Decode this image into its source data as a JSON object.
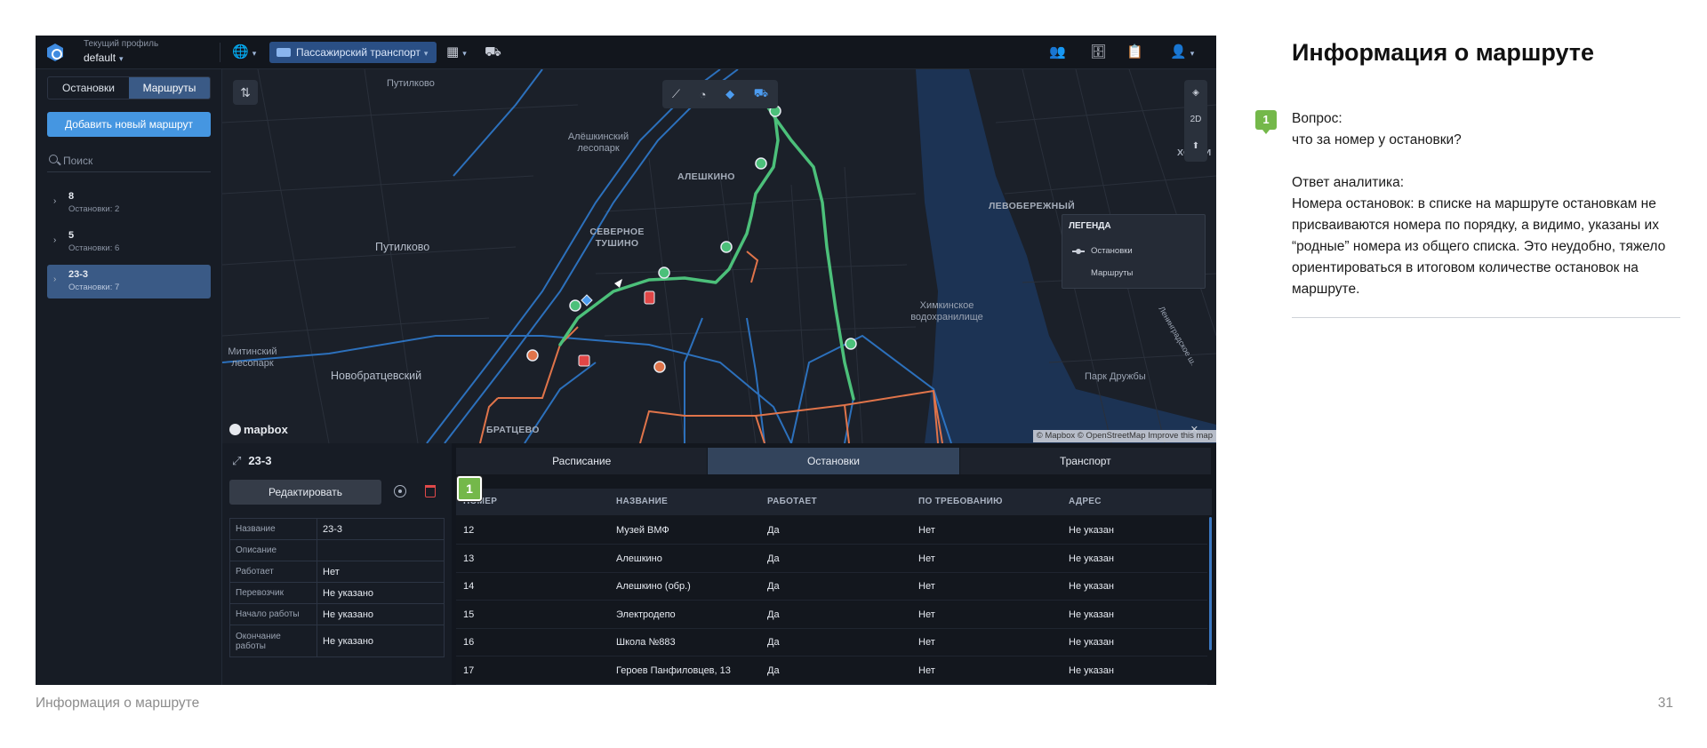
{
  "topbar": {
    "profile_caption": "Текущий профиль",
    "profile_value": "default",
    "mode": "Пассажирский транспорт"
  },
  "sidebar": {
    "tabs": [
      {
        "label": "Остановки",
        "active": false
      },
      {
        "label": "Маршруты",
        "active": true
      }
    ],
    "add_button": "Добавить новый маршрут",
    "search_placeholder": "Поиск",
    "routes": [
      {
        "name": "8",
        "stops": "Остановки: 2",
        "selected": false
      },
      {
        "name": "5",
        "stops": "Остановки: 6",
        "selected": false
      },
      {
        "name": "23-3",
        "stops": "Остановки: 7",
        "selected": true
      }
    ]
  },
  "map": {
    "labels": {
      "putilkovo_top": "Путилково",
      "aleshkinsky": "Алёшкинский лесопарк",
      "aleshkino": "АЛЕШКИНО",
      "levoberezhny": "ЛЕВОБЕРЕЖНЫЙ",
      "khovrino": "ХОВРИ",
      "putilkovo": "Путилково",
      "severnoe_tushino": "СЕВЕРНОЕ ТУШИНО",
      "khimkinskoe": "Химкинское водохранилище",
      "mitinsky": "Митинский лесопарк",
      "novobratsevsky": "Новобратцевский",
      "park_druzhby": "Парк Дружбы",
      "bratsevo": "БРАТЦЕВО",
      "side_road": "Ленинградское ш."
    },
    "side_2d": "2D",
    "legend": {
      "title": "ЛЕГЕНДА",
      "stops": "Остановки",
      "routes": "Маршруты"
    },
    "mapbox": "mapbox",
    "attribution": "© Mapbox © OpenStreetMap  Improve this map",
    "colors": {
      "route": "#4cc07a",
      "roads": "#2f7fd6",
      "alt_route": "#e0744a",
      "water": "#1c3354"
    }
  },
  "details": {
    "route_name": "23-3",
    "edit_button": "Редактировать",
    "props": [
      {
        "key": "Название",
        "value": "23-3"
      },
      {
        "key": "Описание",
        "value": ""
      },
      {
        "key": "Работает",
        "value": "Нет"
      },
      {
        "key": "Перевозчик",
        "value": "Не указано"
      },
      {
        "key": "Начало работы",
        "value": "Не указано"
      },
      {
        "key": "Окончание работы",
        "value": "Не указано"
      }
    ]
  },
  "stops_panel": {
    "tabs": [
      {
        "label": "Расписание",
        "active": false
      },
      {
        "label": "Остановки",
        "active": true
      },
      {
        "label": "Транспорт",
        "active": false
      }
    ],
    "columns": [
      "НОМЕР",
      "НАЗВАНИЕ",
      "РАБОТАЕТ",
      "ПО ТРЕБОВАНИЮ",
      "АДРЕС"
    ],
    "rows": [
      [
        "12",
        "Музей ВМФ",
        "Да",
        "Нет",
        "Не указан"
      ],
      [
        "13",
        "Алешкино",
        "Да",
        "Нет",
        "Не указан"
      ],
      [
        "14",
        "Алешкино (обр.)",
        "Да",
        "Нет",
        "Не указан"
      ],
      [
        "15",
        "Электродепо",
        "Да",
        "Нет",
        "Не указан"
      ],
      [
        "16",
        "Школа №883",
        "Да",
        "Нет",
        "Не указан"
      ],
      [
        "17",
        "Героев Панфиловцев, 13",
        "Да",
        "Нет",
        "Не указан"
      ]
    ],
    "marker": "1"
  },
  "note": {
    "title": "Информация о маршруте",
    "badge": "1",
    "question_label": "Вопрос:",
    "question": "что за номер у остановки?",
    "answer_label": "Ответ аналитика:",
    "answer": "Номера остановок: в списке на маршруте остановкам не присваиваются номера по порядку, а видимо, указаны их “родные” номера из общего списка. Это неудобно, тяжело ориентироваться в итоговом количестве остановок на маршруте."
  },
  "footer": {
    "left": "Информация о маршруте",
    "page": "31"
  }
}
